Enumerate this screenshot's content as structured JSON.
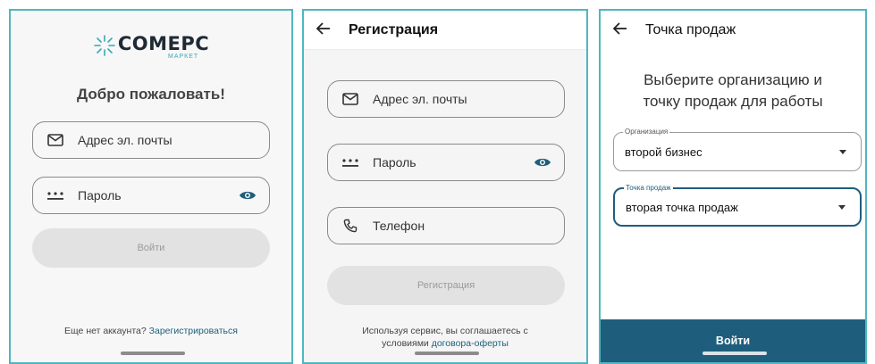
{
  "login": {
    "logo_text": "COMEPC",
    "logo_sub": "МАРКЕТ",
    "welcome": "Добро пожаловать!",
    "email_placeholder": "Адрес эл. почты",
    "password_placeholder": "Пароль",
    "login_button": "Войти",
    "no_account_text": "Еще нет аккаунта?",
    "register_link": "Зарегистрироваться"
  },
  "register": {
    "title": "Регистрация",
    "email_placeholder": "Адрес эл. почты",
    "password_placeholder": "Пароль",
    "phone_placeholder": "Телефон",
    "register_button": "Регистрация",
    "terms_line1": "Используя сервис, вы соглашаетесь с",
    "terms_line2_prefix": "условиями",
    "terms_link": "договора-оферты"
  },
  "point_of_sale": {
    "title": "Точка продаж",
    "heading_line1": "Выберите организацию и",
    "heading_line2": "точку продаж для работы",
    "organization_label": "Организация",
    "organization_value": "второй бизнес",
    "point_label": "Точка продаж",
    "point_value": "вторая точка продаж",
    "login_button": "Войти"
  },
  "colors": {
    "accent": "#1e5e7c",
    "panel_border": "#4fb7c0",
    "logo_star": "#3aa6b5"
  }
}
